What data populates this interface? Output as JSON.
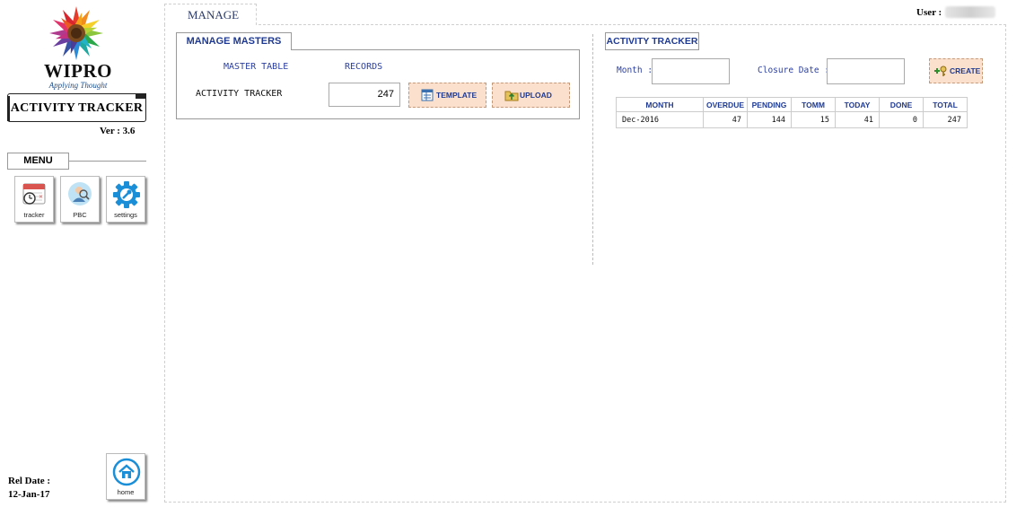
{
  "brand": {
    "name": "WIPRO",
    "tagline": "Applying Thought"
  },
  "app": {
    "title": "ACTIVITY TRACKER",
    "version": "Ver : 3.6"
  },
  "menu": {
    "label": "MENU",
    "items": [
      {
        "label": "tracker",
        "icon": "calendar-clock-icon"
      },
      {
        "label": "PBC",
        "icon": "person-search-icon"
      },
      {
        "label": "settings",
        "icon": "gear-icon"
      }
    ],
    "home": {
      "label": "home",
      "icon": "home-icon"
    }
  },
  "release": {
    "label": "Rel Date :",
    "date": "12-Jan-17"
  },
  "header": {
    "tab": "MANAGE",
    "user_label": "User :",
    "user_value": ""
  },
  "masters": {
    "tab": "MANAGE MASTERS",
    "col_table": "MASTER TABLE",
    "col_records": "RECORDS",
    "row_label": "ACTIVITY TRACKER",
    "records": "247",
    "template_label": "TEMPLATE",
    "upload_label": "UPLOAD"
  },
  "tracker": {
    "tab": "ACTIVITY TRACKER",
    "month_label": "Month :",
    "closure_label": "Closure Date :",
    "month_value": "",
    "closure_value": "",
    "create_label": "CREATE",
    "columns": [
      "MONTH",
      "OVERDUE",
      "PENDING",
      "TOMM",
      "TODAY",
      "DONE",
      "TOTAL"
    ],
    "rows": [
      [
        "Dec-2016",
        "47",
        "144",
        "15",
        "41",
        "0",
        "247"
      ]
    ]
  },
  "colors": {
    "accent_blue": "#1f3a93",
    "button_fill": "#fbe1cd",
    "button_border": "#c49a7a",
    "icon_blue": "#1a8fd8"
  }
}
